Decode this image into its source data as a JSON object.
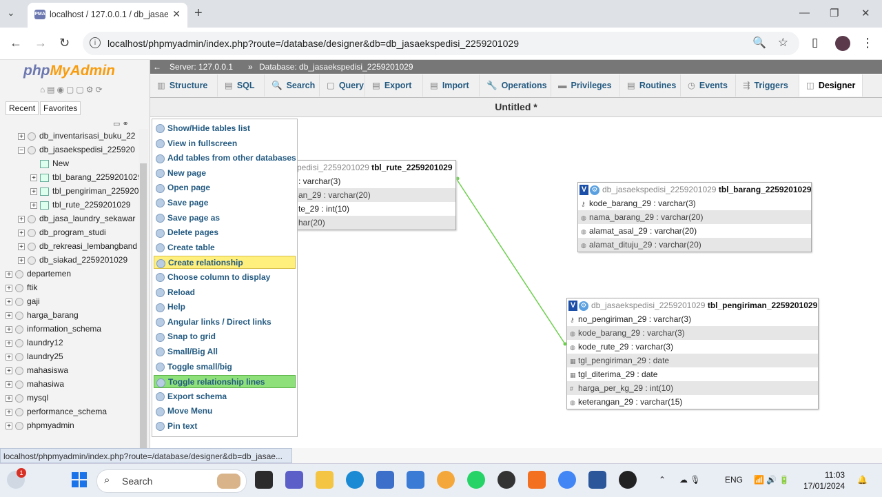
{
  "browser": {
    "tab_title": "localhost / 127.0.0.1 / db_jasaeksp",
    "favicon_text": "PMA",
    "tab_close": "✕",
    "new_tab": "+",
    "tab_search": "⌄",
    "url": "localhost/phpmyadmin/index.php?route=/database/designer&db=db_jasaekspedisi_2259201029",
    "window_minimize": "—",
    "window_restore": "❐",
    "window_close": "✕",
    "back": "←",
    "forward": "→",
    "reload": "↻",
    "zoom": "🔍",
    "star": "☆",
    "sidebar_toggle": "▯",
    "menu": "⋮",
    "info": "i"
  },
  "pma": {
    "logo_php": "php",
    "logo_myadmin": "MyAdmin",
    "logo_icons": "⌂▤◉▢▢⚙⟳",
    "nav_tabs": [
      "Recent",
      "Favorites"
    ],
    "collapse_icons": "▭ ⚭",
    "tree": [
      {
        "label": "db_inventarisasi_buku_22",
        "level": 1,
        "pm": "+",
        "type": "db"
      },
      {
        "label": "db_jasaekspedisi_225920",
        "level": 1,
        "pm": "−",
        "type": "db"
      },
      {
        "label": "New",
        "level": 2,
        "pm": "",
        "type": "new"
      },
      {
        "label": "tbl_barang_2259201029",
        "level": 2,
        "pm": "+",
        "type": "table"
      },
      {
        "label": "tbl_pengiriman_225920",
        "level": 2,
        "pm": "+",
        "type": "table"
      },
      {
        "label": "tbl_rute_2259201029",
        "level": 2,
        "pm": "+",
        "type": "table"
      },
      {
        "label": "db_jasa_laundry_sekawar",
        "level": 1,
        "pm": "+",
        "type": "db"
      },
      {
        "label": "db_program_studi",
        "level": 1,
        "pm": "+",
        "type": "db"
      },
      {
        "label": "db_rekreasi_lembangband",
        "level": 1,
        "pm": "+",
        "type": "db"
      },
      {
        "label": "db_siakad_2259201029",
        "level": 1,
        "pm": "+",
        "type": "db"
      },
      {
        "label": "departemen",
        "level": 0,
        "pm": "+",
        "type": "db"
      },
      {
        "label": "ftik",
        "level": 0,
        "pm": "+",
        "type": "db"
      },
      {
        "label": "gaji",
        "level": 0,
        "pm": "+",
        "type": "db"
      },
      {
        "label": "harga_barang",
        "level": 0,
        "pm": "+",
        "type": "db"
      },
      {
        "label": "information_schema",
        "level": 0,
        "pm": "+",
        "type": "db"
      },
      {
        "label": "laundry12",
        "level": 0,
        "pm": "+",
        "type": "db"
      },
      {
        "label": "laundry25",
        "level": 0,
        "pm": "+",
        "type": "db"
      },
      {
        "label": "mahasiswa",
        "level": 0,
        "pm": "+",
        "type": "db"
      },
      {
        "label": "mahasiwa",
        "level": 0,
        "pm": "+",
        "type": "db"
      },
      {
        "label": "mysql",
        "level": 0,
        "pm": "+",
        "type": "db"
      },
      {
        "label": "performance_schema",
        "level": 0,
        "pm": "+",
        "type": "db"
      },
      {
        "label": "phpmyadmin",
        "level": 0,
        "pm": "+",
        "type": "db"
      }
    ],
    "server_arrow": "←",
    "server": "Server: 127.0.0.1",
    "separator": "»",
    "database": "Database: db_jasaekspedisi_2259201029",
    "menu_tabs": [
      {
        "label": "Structure",
        "icon": "▥"
      },
      {
        "label": "SQL",
        "icon": "▤"
      },
      {
        "label": "Search",
        "icon": "🔍"
      },
      {
        "label": "Query",
        "icon": "▢"
      },
      {
        "label": "Export",
        "icon": "▤"
      },
      {
        "label": "Import",
        "icon": "▤"
      },
      {
        "label": "Operations",
        "icon": "🔧"
      },
      {
        "label": "Privileges",
        "icon": "▬"
      },
      {
        "label": "Routines",
        "icon": "▤"
      },
      {
        "label": "Events",
        "icon": "◷"
      },
      {
        "label": "Triggers",
        "icon": "⇶"
      },
      {
        "label": "Designer",
        "icon": "◫"
      }
    ],
    "page_title": "Untitled *",
    "side_menu": [
      "Show/Hide tables list",
      "View in fullscreen",
      "Add tables from other databases",
      "New page",
      "Open page",
      "Save page",
      "Save page as",
      "Delete pages",
      "Create table",
      "Create relationship",
      "Choose column to display",
      "Reload",
      "Help",
      "Angular links / Direct links",
      "Snap to grid",
      "Small/Big All",
      "Toggle small/big",
      "Toggle relationship lines",
      "Export schema",
      "Move Menu",
      "Pin text"
    ],
    "tables": {
      "rute": {
        "db": "pedisi_2259201029",
        "name": "tbl_rute_2259201029",
        "rows": [
          ": varchar(3)",
          "an_29 : varchar(20)",
          "te_29 : int(10)",
          "har(20)"
        ]
      },
      "barang": {
        "v": "V",
        "db": "db_jasaekspedisi_2259201029",
        "name": "tbl_barang_2259201029",
        "rows": [
          "kode_barang_29 : varchar(3)",
          "nama_barang_29 : varchar(20)",
          "alamat_asal_29 : varchar(20)",
          "alamat_dituju_29 : varchar(20)"
        ]
      },
      "pengiriman": {
        "v": "V",
        "db": "db_jasaekspedisi_2259201029",
        "name": "tbl_pengiriman_2259201029",
        "rows": [
          "no_pengiriman_29 : varchar(3)",
          "kode_barang_29 : varchar(3)",
          "kode_rute_29 : varchar(3)",
          "tgl_pengiriman_29 : date",
          "tgl_diterima_29 : date",
          "harga_per_kg_29 : int(10)",
          "keterangan_29 : varchar(15)"
        ]
      }
    },
    "status_url": "localhost/phpmyadmin/index.php?route=/database/designer&db=db_jasae..."
  },
  "taskbar": {
    "badge": "1",
    "search": "Search",
    "lang": "ENG",
    "time": "11:03",
    "date": "17/01/2024",
    "tray_chevron": "⌃",
    "tray_icons": "☁ 🎙",
    "sys_icons": "📶 🔊 🔋",
    "bell": "🔔"
  },
  "colors": {
    "relationship_line": "#6ccf4c",
    "pma_link": "#235a81",
    "highlight_yellow": "#ffef7d",
    "highlight_green": "#8ee07a"
  }
}
